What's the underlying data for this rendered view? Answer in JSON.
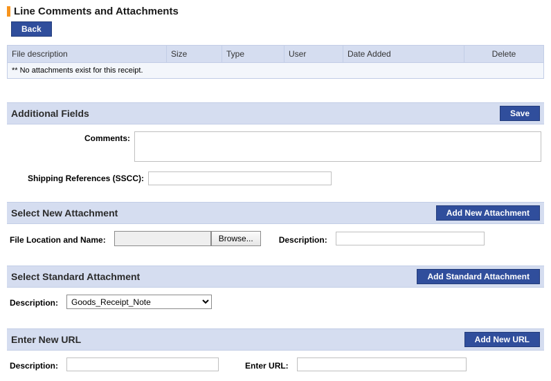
{
  "page": {
    "title": "Line Comments and Attachments",
    "back_label": "Back"
  },
  "att_table": {
    "headers": {
      "file_desc": "File description",
      "size": "Size",
      "type": "Type",
      "user": "User",
      "date_added": "Date Added",
      "delete": "Delete"
    },
    "empty_msg": "** No attachments exist for this receipt."
  },
  "additional_fields": {
    "title": "Additional Fields",
    "save_label": "Save",
    "comments_label": "Comments:",
    "comments_value": "",
    "sscc_label": "Shipping References (SSCC):",
    "sscc_value": ""
  },
  "select_new_attachment": {
    "title": "Select New Attachment",
    "add_label": "Add New Attachment",
    "file_loc_label": "File Location and Name:",
    "file_loc_value": "",
    "browse_label": "Browse...",
    "desc_label": "Description:",
    "desc_value": ""
  },
  "select_standard_attachment": {
    "title": "Select Standard Attachment",
    "add_label": "Add Standard Attachment",
    "desc_label": "Description:",
    "desc_selected": "Goods_Receipt_Note"
  },
  "enter_new_url": {
    "title": "Enter New URL",
    "add_label": "Add New URL",
    "desc_label": "Description:",
    "desc_value": "",
    "url_label": "Enter URL:",
    "url_value": ""
  }
}
